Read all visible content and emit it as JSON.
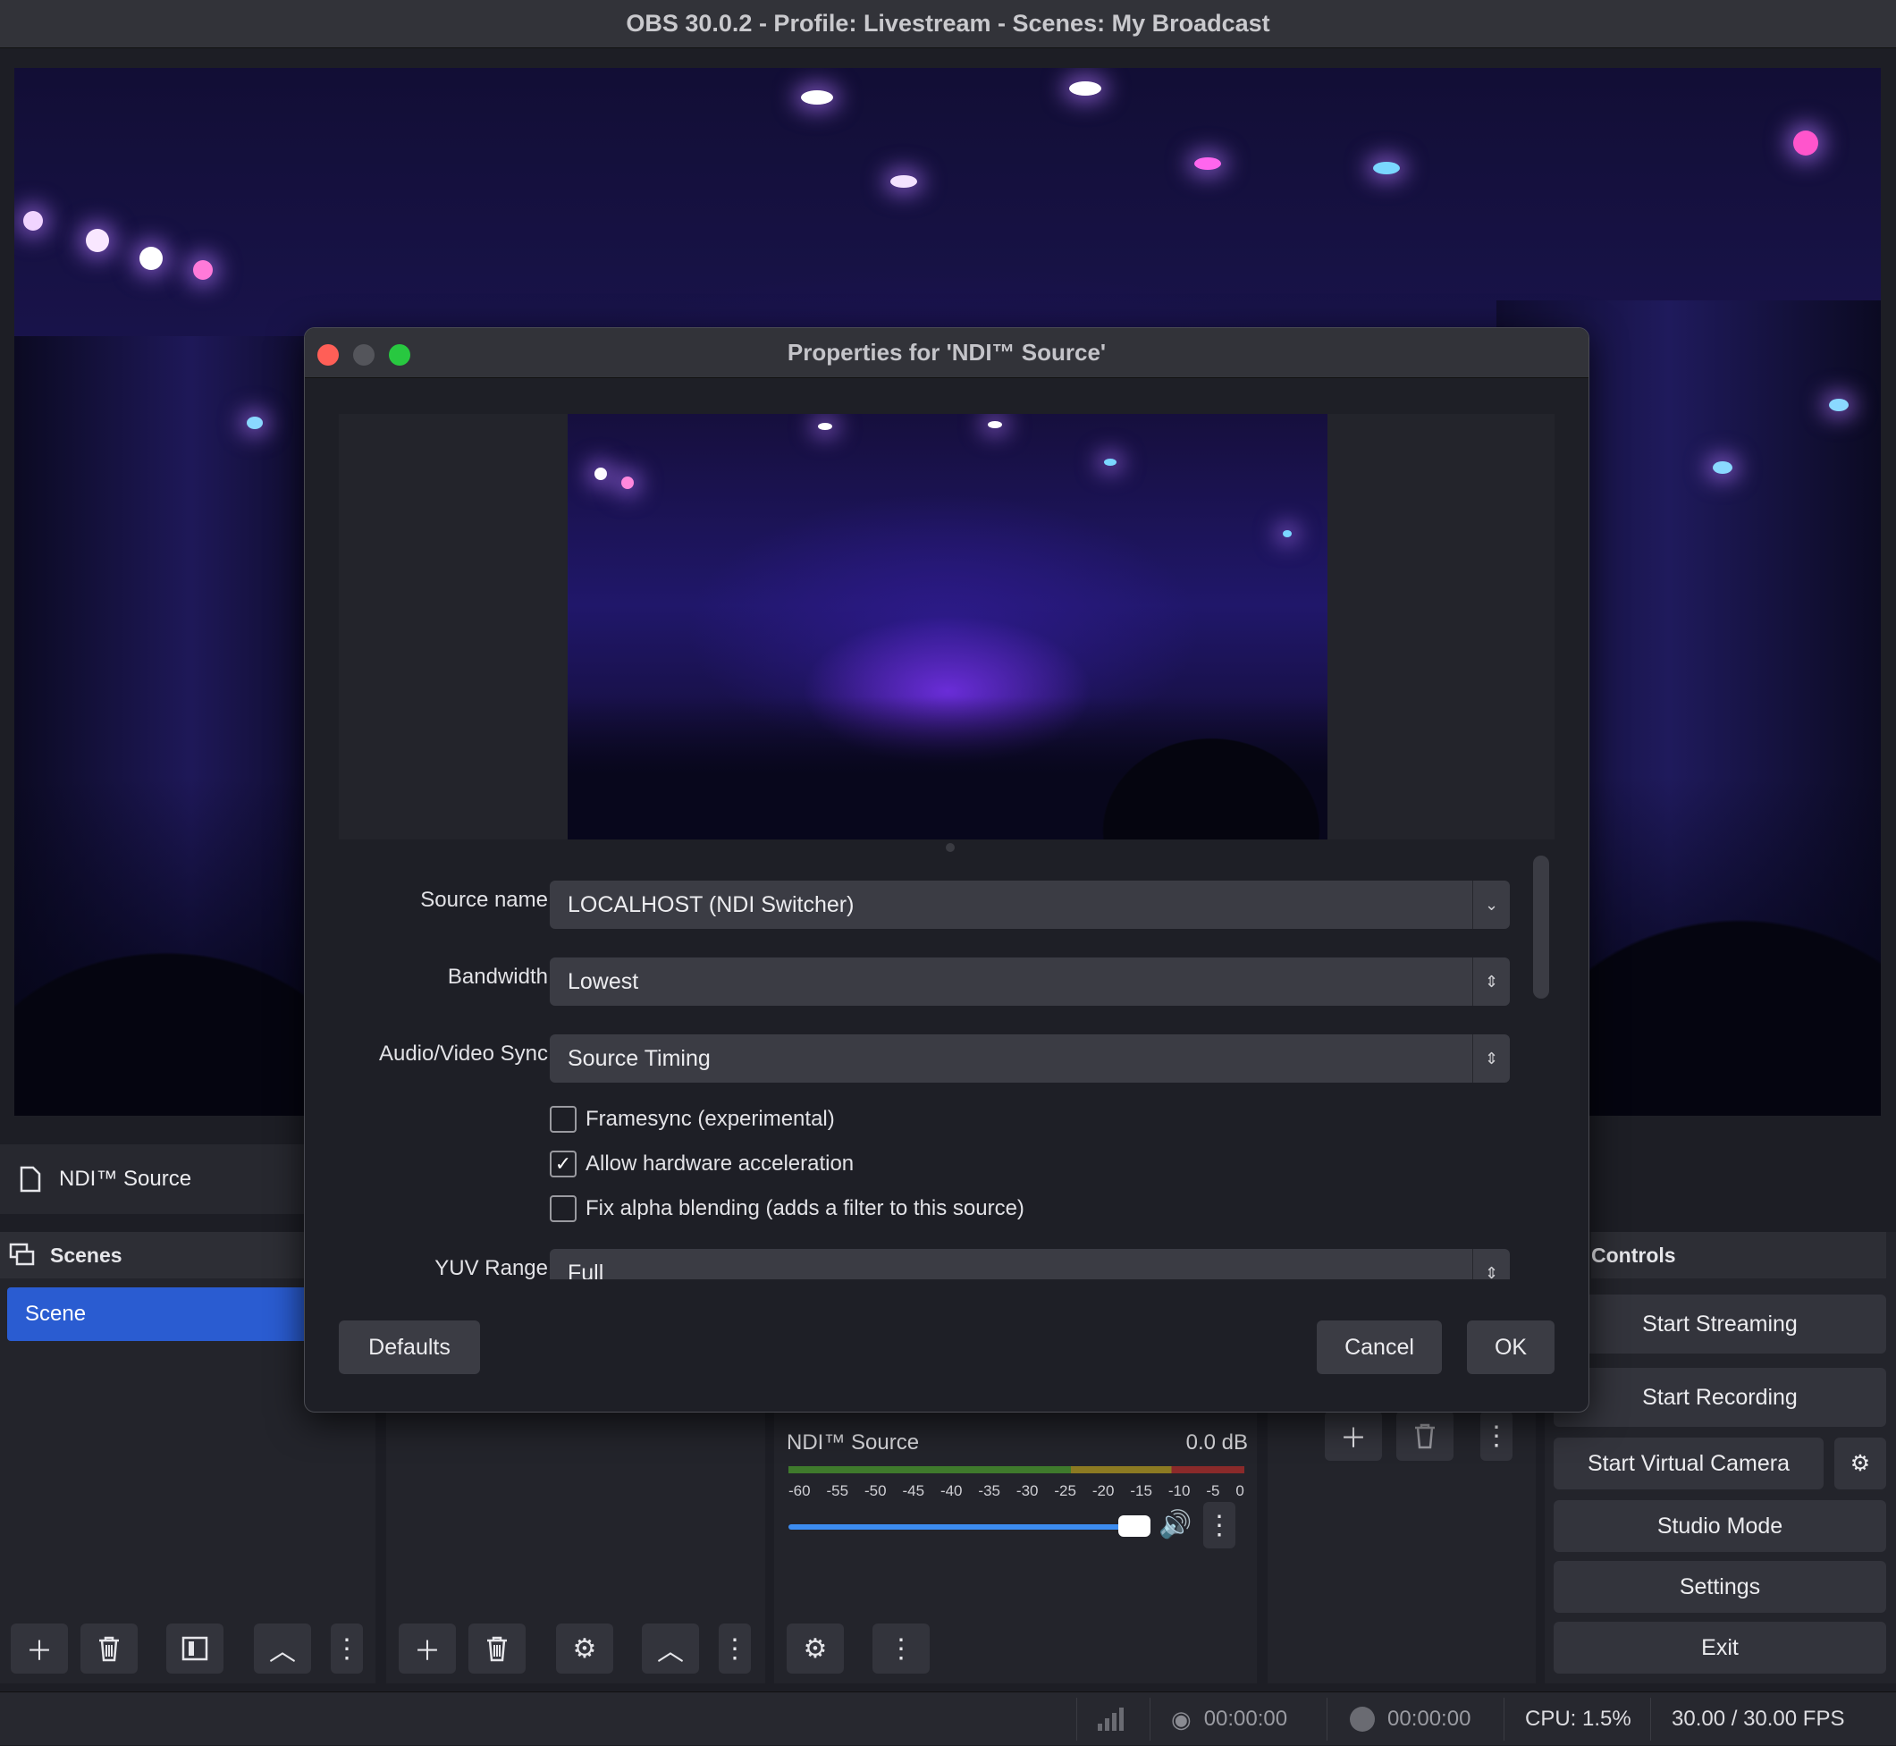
{
  "window": {
    "title": "OBS 30.0.2 - Profile: Livestream - Scenes: My Broadcast"
  },
  "source_bar": {
    "label": "NDI™ Source",
    "icon": "file-icon"
  },
  "scenes": {
    "title": "Scenes",
    "items": [
      "Scene"
    ]
  },
  "controls": {
    "title": "Controls",
    "start_streaming": "Start Streaming",
    "start_recording": "Start Recording",
    "start_virtual_camera": "Start Virtual Camera",
    "studio_mode": "Studio Mode",
    "settings": "Settings",
    "exit": "Exit"
  },
  "mixer": {
    "source": "NDI™ Source",
    "level": "0.0 dB",
    "ticks": [
      "-60",
      "-55",
      "-50",
      "-45",
      "-40",
      "-35",
      "-30",
      "-25",
      "-20",
      "-15",
      "-10",
      "-5",
      "0"
    ],
    "volume_fraction": 0.9
  },
  "status": {
    "stream_time": "00:00:00",
    "record_time": "00:00:00",
    "cpu": "CPU: 1.5%",
    "fps": "30.00 / 30.00 FPS"
  },
  "dialog": {
    "title": "Properties for 'NDI™ Source'",
    "fields": {
      "source_name": {
        "label": "Source name",
        "value": "LOCALHOST (NDI Switcher)"
      },
      "bandwidth": {
        "label": "Bandwidth",
        "value": "Lowest"
      },
      "av_sync": {
        "label": "Audio/Video Sync",
        "value": "Source Timing"
      },
      "yuv_range": {
        "label": "YUV Range",
        "value": "Full"
      }
    },
    "checkboxes": {
      "framesync": {
        "label": "Framesync (experimental)",
        "checked": false
      },
      "hw_accel": {
        "label": "Allow hardware acceleration",
        "checked": true
      },
      "fix_alpha": {
        "label": "Fix alpha blending (adds a filter to this source)",
        "checked": false
      }
    },
    "buttons": {
      "defaults": "Defaults",
      "cancel": "Cancel",
      "ok": "OK"
    }
  },
  "colors": {
    "accent": "#2a5cd1",
    "close": "#ff5f57",
    "zoom": "#28c840"
  }
}
